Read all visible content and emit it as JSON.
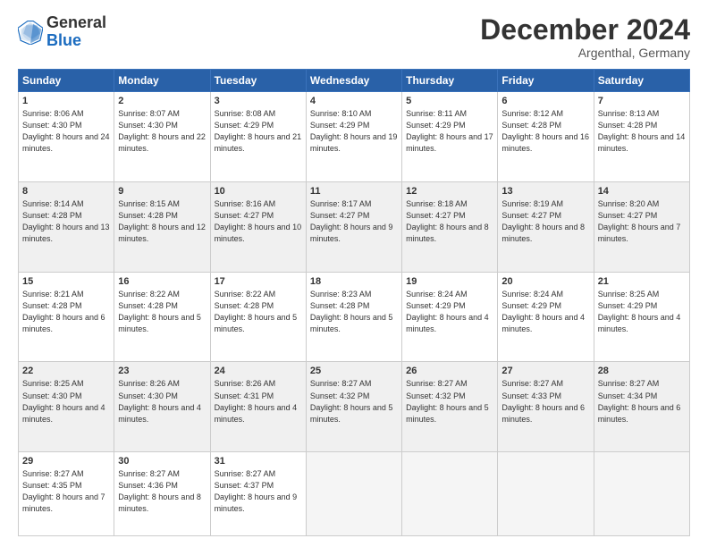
{
  "logo": {
    "general": "General",
    "blue": "Blue"
  },
  "header": {
    "month": "December 2024",
    "location": "Argenthal, Germany"
  },
  "weekdays": [
    "Sunday",
    "Monday",
    "Tuesday",
    "Wednesday",
    "Thursday",
    "Friday",
    "Saturday"
  ],
  "weeks": [
    [
      {
        "day": "1",
        "sunrise": "8:06 AM",
        "sunset": "4:30 PM",
        "daylight": "8 hours and 24 minutes."
      },
      {
        "day": "2",
        "sunrise": "8:07 AM",
        "sunset": "4:30 PM",
        "daylight": "8 hours and 22 minutes."
      },
      {
        "day": "3",
        "sunrise": "8:08 AM",
        "sunset": "4:29 PM",
        "daylight": "8 hours and 21 minutes."
      },
      {
        "day": "4",
        "sunrise": "8:10 AM",
        "sunset": "4:29 PM",
        "daylight": "8 hours and 19 minutes."
      },
      {
        "day": "5",
        "sunrise": "8:11 AM",
        "sunset": "4:29 PM",
        "daylight": "8 hours and 17 minutes."
      },
      {
        "day": "6",
        "sunrise": "8:12 AM",
        "sunset": "4:28 PM",
        "daylight": "8 hours and 16 minutes."
      },
      {
        "day": "7",
        "sunrise": "8:13 AM",
        "sunset": "4:28 PM",
        "daylight": "8 hours and 14 minutes."
      }
    ],
    [
      {
        "day": "8",
        "sunrise": "8:14 AM",
        "sunset": "4:28 PM",
        "daylight": "8 hours and 13 minutes."
      },
      {
        "day": "9",
        "sunrise": "8:15 AM",
        "sunset": "4:28 PM",
        "daylight": "8 hours and 12 minutes."
      },
      {
        "day": "10",
        "sunrise": "8:16 AM",
        "sunset": "4:27 PM",
        "daylight": "8 hours and 10 minutes."
      },
      {
        "day": "11",
        "sunrise": "8:17 AM",
        "sunset": "4:27 PM",
        "daylight": "8 hours and 9 minutes."
      },
      {
        "day": "12",
        "sunrise": "8:18 AM",
        "sunset": "4:27 PM",
        "daylight": "8 hours and 8 minutes."
      },
      {
        "day": "13",
        "sunrise": "8:19 AM",
        "sunset": "4:27 PM",
        "daylight": "8 hours and 8 minutes."
      },
      {
        "day": "14",
        "sunrise": "8:20 AM",
        "sunset": "4:27 PM",
        "daylight": "8 hours and 7 minutes."
      }
    ],
    [
      {
        "day": "15",
        "sunrise": "8:21 AM",
        "sunset": "4:28 PM",
        "daylight": "8 hours and 6 minutes."
      },
      {
        "day": "16",
        "sunrise": "8:22 AM",
        "sunset": "4:28 PM",
        "daylight": "8 hours and 5 minutes."
      },
      {
        "day": "17",
        "sunrise": "8:22 AM",
        "sunset": "4:28 PM",
        "daylight": "8 hours and 5 minutes."
      },
      {
        "day": "18",
        "sunrise": "8:23 AM",
        "sunset": "4:28 PM",
        "daylight": "8 hours and 5 minutes."
      },
      {
        "day": "19",
        "sunrise": "8:24 AM",
        "sunset": "4:29 PM",
        "daylight": "8 hours and 4 minutes."
      },
      {
        "day": "20",
        "sunrise": "8:24 AM",
        "sunset": "4:29 PM",
        "daylight": "8 hours and 4 minutes."
      },
      {
        "day": "21",
        "sunrise": "8:25 AM",
        "sunset": "4:29 PM",
        "daylight": "8 hours and 4 minutes."
      }
    ],
    [
      {
        "day": "22",
        "sunrise": "8:25 AM",
        "sunset": "4:30 PM",
        "daylight": "8 hours and 4 minutes."
      },
      {
        "day": "23",
        "sunrise": "8:26 AM",
        "sunset": "4:30 PM",
        "daylight": "8 hours and 4 minutes."
      },
      {
        "day": "24",
        "sunrise": "8:26 AM",
        "sunset": "4:31 PM",
        "daylight": "8 hours and 4 minutes."
      },
      {
        "day": "25",
        "sunrise": "8:27 AM",
        "sunset": "4:32 PM",
        "daylight": "8 hours and 5 minutes."
      },
      {
        "day": "26",
        "sunrise": "8:27 AM",
        "sunset": "4:32 PM",
        "daylight": "8 hours and 5 minutes."
      },
      {
        "day": "27",
        "sunrise": "8:27 AM",
        "sunset": "4:33 PM",
        "daylight": "8 hours and 6 minutes."
      },
      {
        "day": "28",
        "sunrise": "8:27 AM",
        "sunset": "4:34 PM",
        "daylight": "8 hours and 6 minutes."
      }
    ],
    [
      {
        "day": "29",
        "sunrise": "8:27 AM",
        "sunset": "4:35 PM",
        "daylight": "8 hours and 7 minutes."
      },
      {
        "day": "30",
        "sunrise": "8:27 AM",
        "sunset": "4:36 PM",
        "daylight": "8 hours and 8 minutes."
      },
      {
        "day": "31",
        "sunrise": "8:27 AM",
        "sunset": "4:37 PM",
        "daylight": "8 hours and 9 minutes."
      },
      null,
      null,
      null,
      null
    ]
  ]
}
